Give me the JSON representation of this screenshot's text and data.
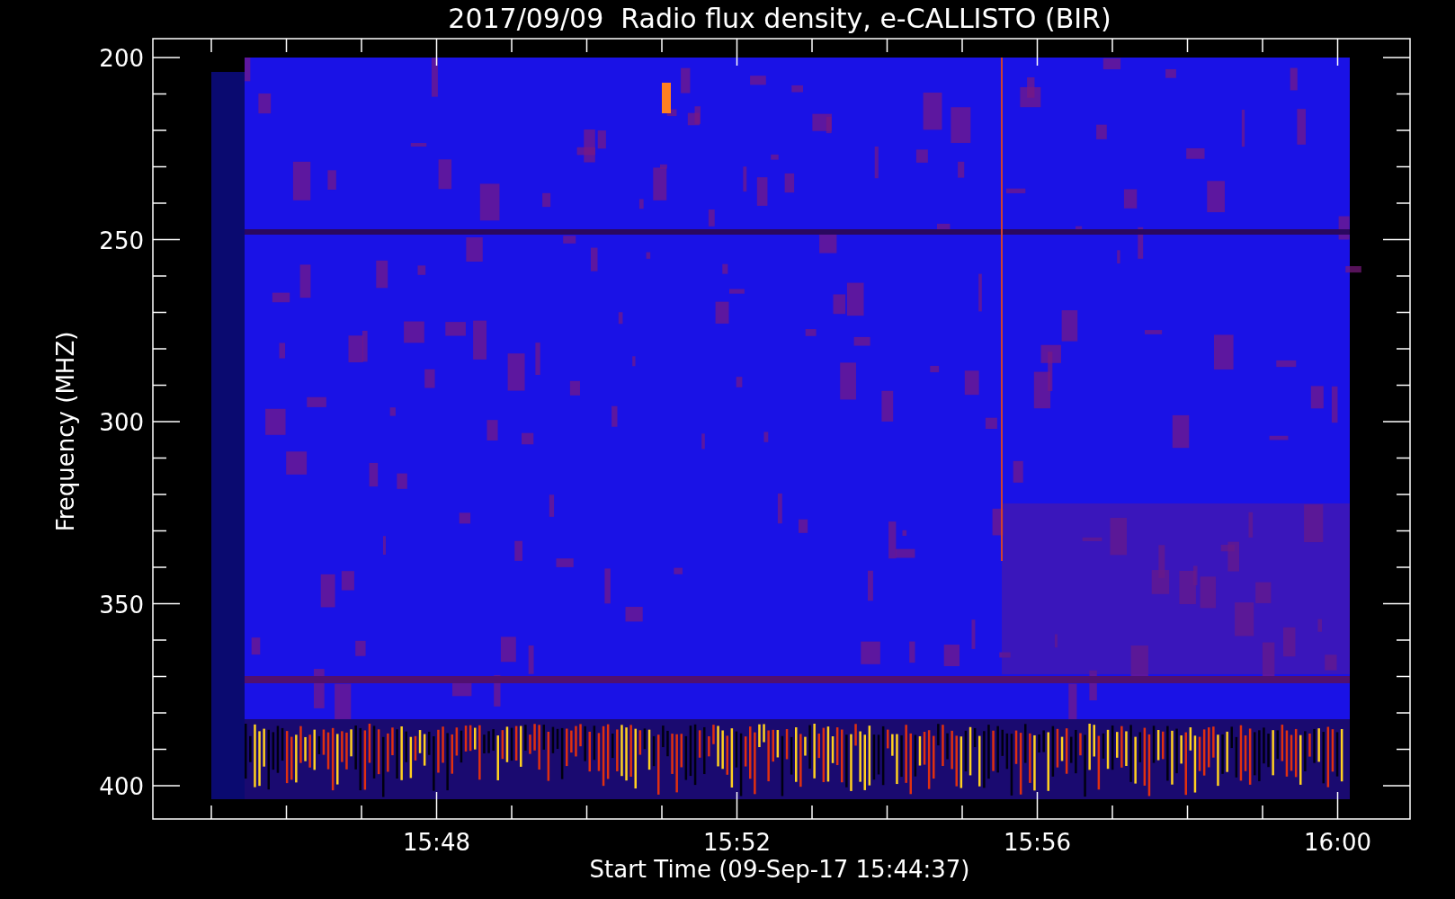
{
  "title": "2017/09/09  Radio flux density, e-CALLISTO (BIR)",
  "y_axis": {
    "label": "Frequency (MHZ)",
    "ticks": [
      "200",
      "250",
      "300",
      "350",
      "400"
    ]
  },
  "x_axis": {
    "label": "Start Time (09-Sep-17 15:44:37)",
    "ticks": [
      "15:48",
      "15:52",
      "15:56",
      "16:00"
    ]
  }
}
